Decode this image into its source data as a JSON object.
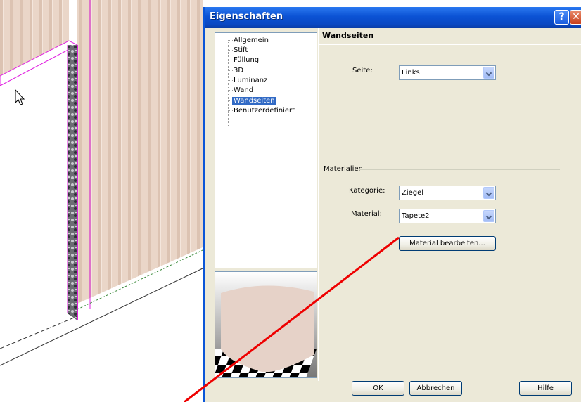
{
  "dialog": {
    "title": "Eigenschaften",
    "help_glyph": "?",
    "close_glyph": "✕"
  },
  "tree": {
    "items": [
      "Allgemein",
      "Stift",
      "Füllung",
      "3D",
      "Luminanz",
      "Wand",
      "Wandseiten",
      "Benutzerdefiniert"
    ],
    "selected": "Wandseiten"
  },
  "panel": {
    "section_title": "Wandseiten",
    "seite_label": "Seite:",
    "seite_value": "Links",
    "materialien_group": "Materialien",
    "kategorie_label": "Kategorie:",
    "kategorie_value": "Ziegel",
    "material_label": "Material:",
    "material_value": "Tapete2",
    "edit_button": "Material bearbeiten..."
  },
  "footer": {
    "ok": "OK",
    "cancel": "Abbrechen",
    "help": "Hilfe"
  },
  "colors": {
    "titlebar": "#0a52d4",
    "dialog_bg": "#ece9d8",
    "selection": "#316ac5",
    "wall": "#e8d2c3",
    "wall_edge": "#e020e0",
    "annotation_line": "#ee0000"
  },
  "icons": [
    "mouse-cursor-icon",
    "help-icon",
    "close-icon",
    "dropdown-arrow-icon"
  ]
}
